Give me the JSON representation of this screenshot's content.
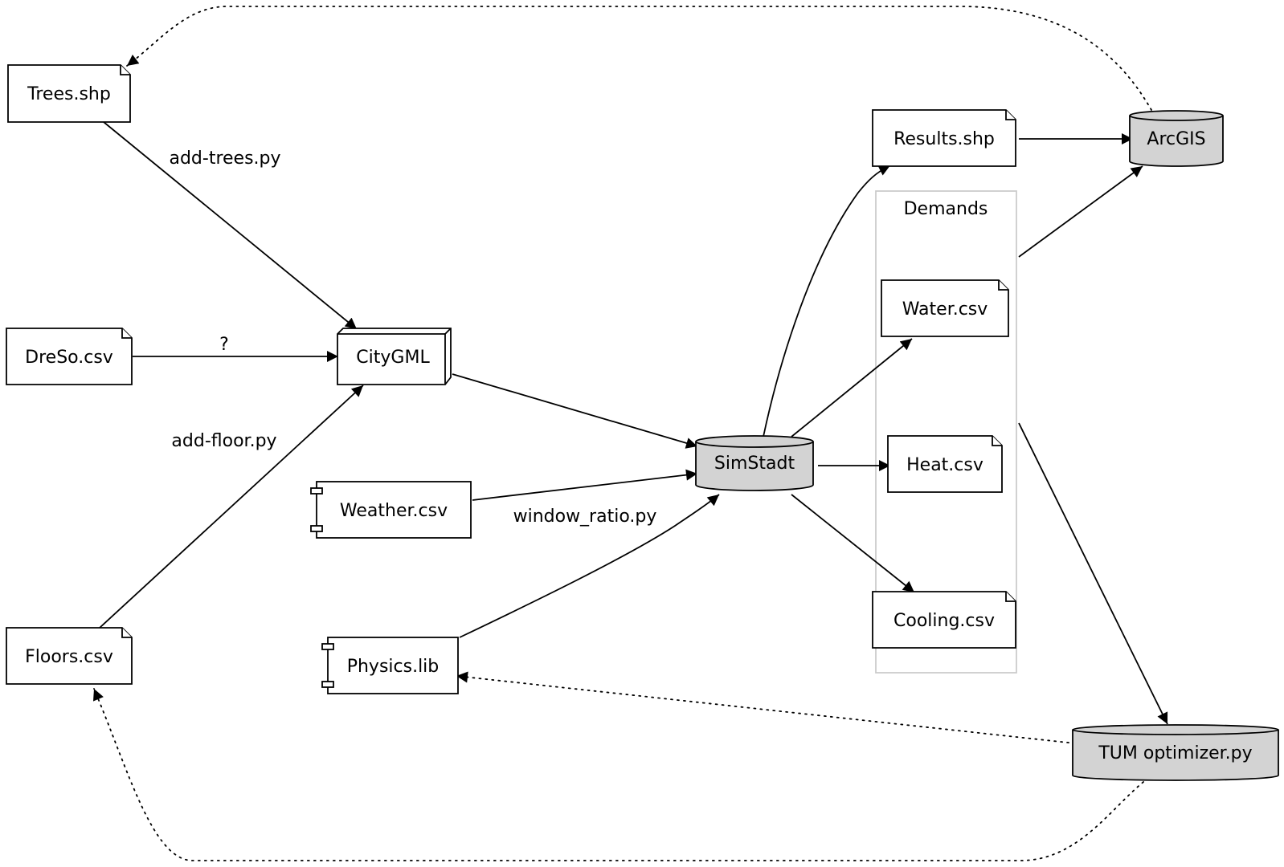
{
  "diagram": {
    "title": "",
    "nodes": [
      {
        "id": "trees",
        "label": "Trees.shp",
        "shape": "note"
      },
      {
        "id": "dreso",
        "label": "DreSo.csv",
        "shape": "note"
      },
      {
        "id": "floors",
        "label": "Floors.csv",
        "shape": "note"
      },
      {
        "id": "citygml",
        "label": "CityGML",
        "shape": "box3d"
      },
      {
        "id": "weather",
        "label": "Weather.csv",
        "shape": "component"
      },
      {
        "id": "physics",
        "label": "Physics.lib",
        "shape": "component"
      },
      {
        "id": "simstadt",
        "label": "SimStadt",
        "shape": "cylinder",
        "fill": "#d3d3d3"
      },
      {
        "id": "results",
        "label": "Results.shp",
        "shape": "note"
      },
      {
        "id": "water",
        "label": "Water.csv",
        "shape": "note"
      },
      {
        "id": "heat",
        "label": "Heat.csv",
        "shape": "note"
      },
      {
        "id": "cooling",
        "label": "Cooling.csv",
        "shape": "note"
      },
      {
        "id": "arcgis",
        "label": "ArcGIS",
        "shape": "cylinder",
        "fill": "#d3d3d3"
      },
      {
        "id": "tum",
        "label": "TUM optimizer.py",
        "shape": "cylinder",
        "fill": "#d3d3d3"
      }
    ],
    "clusters": [
      {
        "id": "demands",
        "label": "Demands",
        "members": [
          "water",
          "heat",
          "cooling"
        ],
        "border_color": "#cccccc"
      }
    ],
    "edges": [
      {
        "from": "trees",
        "to": "citygml",
        "label": "add-trees.py",
        "style": "solid"
      },
      {
        "from": "dreso",
        "to": "citygml",
        "label": "?",
        "style": "solid"
      },
      {
        "from": "floors",
        "to": "citygml",
        "label": "add-floor.py",
        "style": "solid"
      },
      {
        "from": "citygml",
        "to": "simstadt",
        "label": "",
        "style": "solid"
      },
      {
        "from": "weather",
        "to": "simstadt",
        "label": "",
        "style": "solid"
      },
      {
        "from": "physics",
        "to": "simstadt",
        "label": "window_ratio.py",
        "style": "solid"
      },
      {
        "from": "simstadt",
        "to": "results",
        "label": "",
        "style": "solid"
      },
      {
        "from": "simstadt",
        "to": "water",
        "label": "",
        "style": "solid"
      },
      {
        "from": "simstadt",
        "to": "heat",
        "label": "",
        "style": "solid"
      },
      {
        "from": "simstadt",
        "to": "cooling",
        "label": "",
        "style": "solid"
      },
      {
        "from": "results",
        "to": "arcgis",
        "label": "",
        "style": "solid"
      },
      {
        "from": "demands",
        "to": "arcgis",
        "label": "",
        "style": "solid"
      },
      {
        "from": "demands",
        "to": "tum",
        "label": "",
        "style": "solid"
      },
      {
        "from": "arcgis",
        "to": "trees",
        "label": "",
        "style": "dotted"
      },
      {
        "from": "tum",
        "to": "physics",
        "label": "",
        "style": "dotted"
      },
      {
        "from": "tum",
        "to": "floors",
        "label": "",
        "style": "dotted"
      }
    ]
  }
}
